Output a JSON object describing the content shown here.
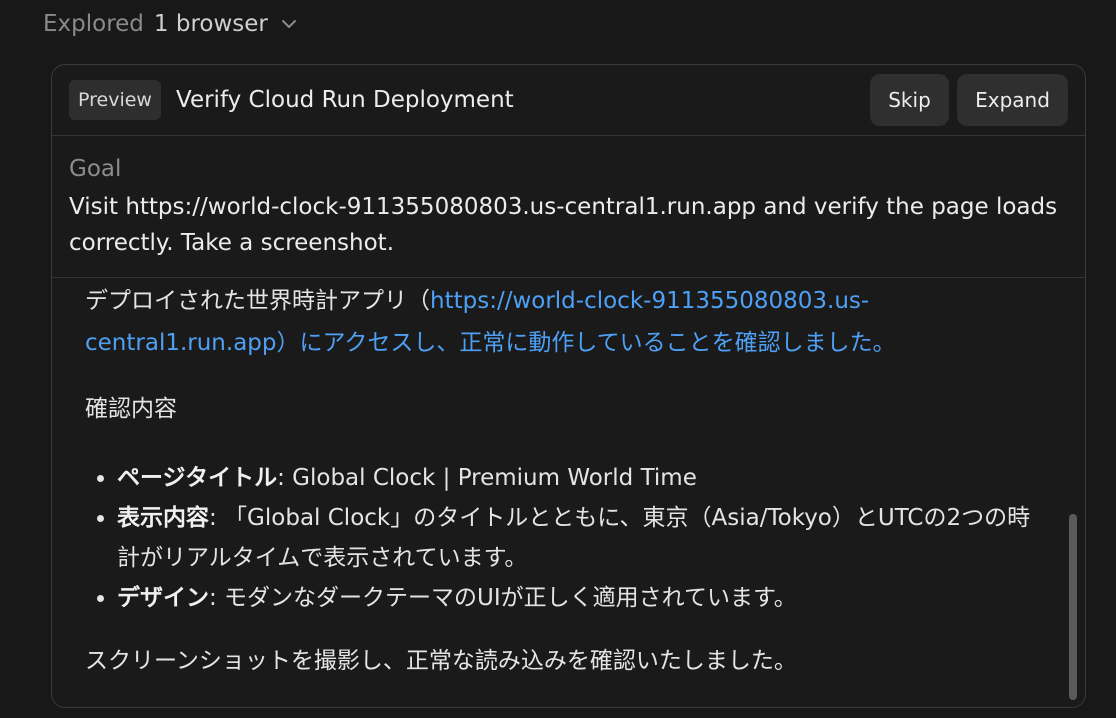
{
  "explored": {
    "label": "Explored",
    "count_text": "1 browser"
  },
  "card": {
    "tag": "Preview",
    "title": "Verify Cloud Run Deployment",
    "skip_label": "Skip",
    "expand_label": "Expand"
  },
  "goal": {
    "label": "Goal",
    "text": "Visit https://world-clock-911355080803.us-central1.run.app and verify the page loads correctly. Take a screenshot."
  },
  "content": {
    "para_prefix": "デプロイされた世界時計アプリ（",
    "para_link": "https://world-clock-911355080803.us-central1.run.app）にアクセスし、正常に動作していることを確認しました。",
    "heading": "確認内容",
    "bullets": [
      {
        "label": "ページタイトル",
        "text": ": Global Clock | Premium World Time"
      },
      {
        "label": "表示内容",
        "text": ": 「Global Clock」のタイトルとともに、東京（Asia/Tokyo）とUTCの2つの時計がリアルタイムで表示されています。"
      },
      {
        "label": "デザイン",
        "text": ": モダンなダークテーマのUIが正しく適用されています。"
      }
    ],
    "closing": "スクリーンショットを撮影し、正常な読み込みを確認いたしました。"
  },
  "colors": {
    "background": "#181818",
    "link": "#4ea0f5",
    "button_bg": "#2f2f2f"
  }
}
